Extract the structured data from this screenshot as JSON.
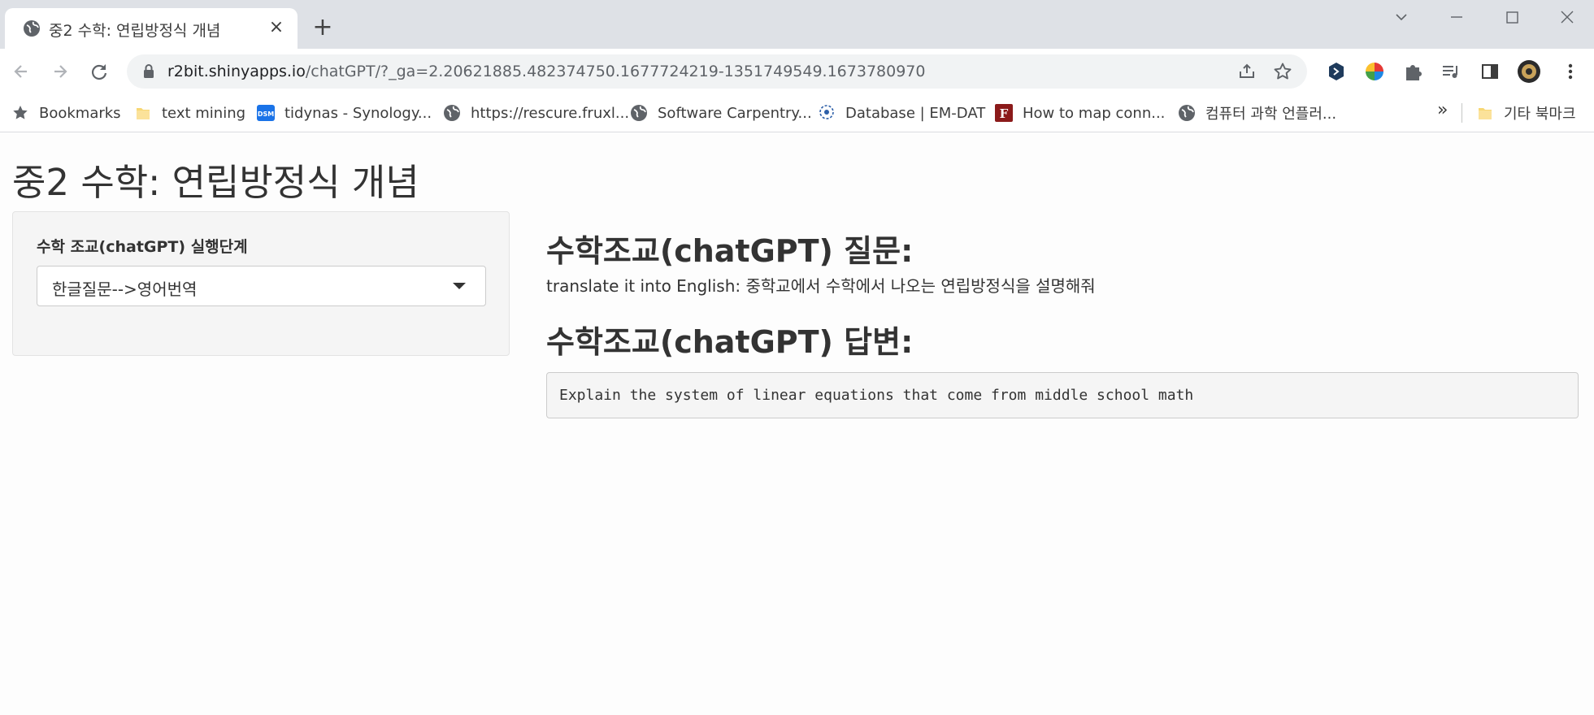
{
  "browser": {
    "tab": {
      "title": "중2 수학: 연립방정식 개념",
      "favicon": "globe-icon",
      "close": "×"
    },
    "new_tab": "+",
    "url": {
      "host": "r2bit.shinyapps.io",
      "path": "/chatGPT/?_ga=2.20621885.482374750.1677724219-1351749549.1673780970"
    },
    "bookmarks": [
      {
        "label": "Bookmarks",
        "icon": "star-icon"
      },
      {
        "label": "text mining",
        "icon": "folder-icon"
      },
      {
        "label": "tidynas - Synology...",
        "icon": "dsm-icon"
      },
      {
        "label": "https://rescure.fruxl...",
        "icon": "globe-icon"
      },
      {
        "label": "Software Carpentry...",
        "icon": "globe-icon"
      },
      {
        "label": "Database | EM-DAT",
        "icon": "emdat-icon"
      },
      {
        "label": "How to map conn...",
        "icon": "f-logo-icon"
      },
      {
        "label": "컴퓨터 과학 언플러...",
        "icon": "globe-icon"
      }
    ],
    "bookmarks_more": "»",
    "other_bookmarks": {
      "label": "기타 북마크",
      "icon": "folder-icon"
    },
    "colors": {
      "tabstrip": "#dee1e6",
      "omnibox": "#f1f3f4",
      "dsm": "#1a73e8",
      "f_logo": "#8b1a1a"
    }
  },
  "page": {
    "title": "중2 수학: 연립방정식 개념",
    "sidebar": {
      "label": "수학 조교(chatGPT) 실행단계",
      "select_value": "한글질문-->영어번역"
    },
    "main": {
      "question_heading": "수학조교(chatGPT) 질문:",
      "question_text": "translate it into English: 중학교에서 수학에서 나오는 연립방정식을 설명해줘",
      "answer_heading": "수학조교(chatGPT) 답변:",
      "answer_text": "Explain the system of linear equations that come from middle school math"
    }
  }
}
